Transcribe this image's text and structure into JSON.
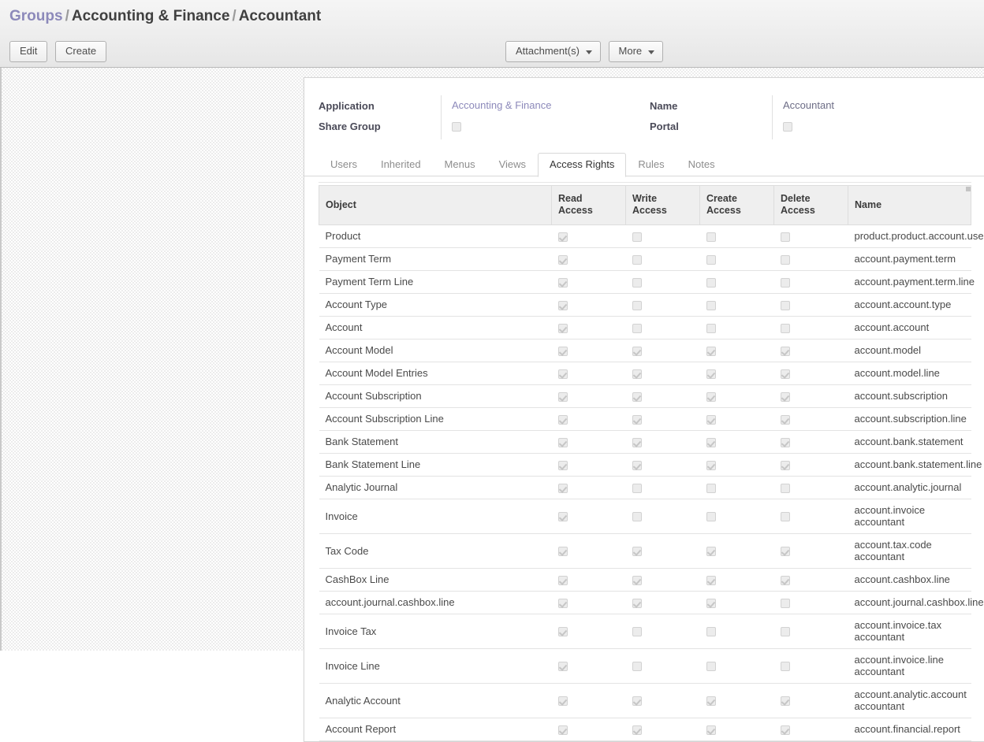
{
  "breadcrumb": {
    "root": "Groups",
    "sep": "/",
    "parent": "Accounting & Finance",
    "current": "Accountant"
  },
  "toolbar": {
    "edit_label": "Edit",
    "create_label": "Create",
    "attachments_label": "Attachment(s)",
    "more_label": "More"
  },
  "form": {
    "labels": {
      "application": "Application",
      "share_group": "Share Group",
      "name": "Name",
      "portal": "Portal"
    },
    "values": {
      "application": "Accounting & Finance",
      "share_group_checked": false,
      "name": "Accountant",
      "portal_checked": false
    }
  },
  "tabs": [
    {
      "label": "Users",
      "active": false
    },
    {
      "label": "Inherited",
      "active": false
    },
    {
      "label": "Menus",
      "active": false
    },
    {
      "label": "Views",
      "active": false
    },
    {
      "label": "Access Rights",
      "active": true
    },
    {
      "label": "Rules",
      "active": false
    },
    {
      "label": "Notes",
      "active": false
    }
  ],
  "table": {
    "columns": [
      "Object",
      "Read Access",
      "Write Access",
      "Create Access",
      "Delete Access",
      "Name"
    ],
    "column_lines": [
      [
        "Object"
      ],
      [
        "Read",
        "Access"
      ],
      [
        "Write",
        "Access"
      ],
      [
        "Create",
        "Access"
      ],
      [
        "Delete",
        "Access"
      ],
      [
        "Name"
      ]
    ],
    "rows": [
      {
        "object": "Product",
        "read": true,
        "write": false,
        "create": false,
        "delete": false,
        "name": "product.product.account.user"
      },
      {
        "object": "Payment Term",
        "read": true,
        "write": false,
        "create": false,
        "delete": false,
        "name": "account.payment.term"
      },
      {
        "object": "Payment Term Line",
        "read": true,
        "write": false,
        "create": false,
        "delete": false,
        "name": "account.payment.term.line"
      },
      {
        "object": "Account Type",
        "read": true,
        "write": false,
        "create": false,
        "delete": false,
        "name": "account.account.type"
      },
      {
        "object": "Account",
        "read": true,
        "write": false,
        "create": false,
        "delete": false,
        "name": "account.account"
      },
      {
        "object": "Account Model",
        "read": true,
        "write": true,
        "create": true,
        "delete": true,
        "name": "account.model"
      },
      {
        "object": "Account Model Entries",
        "read": true,
        "write": true,
        "create": true,
        "delete": true,
        "name": "account.model.line"
      },
      {
        "object": "Account Subscription",
        "read": true,
        "write": true,
        "create": true,
        "delete": true,
        "name": "account.subscription"
      },
      {
        "object": "Account Subscription Line",
        "read": true,
        "write": true,
        "create": true,
        "delete": true,
        "name": "account.subscription.line"
      },
      {
        "object": "Bank Statement",
        "read": true,
        "write": true,
        "create": true,
        "delete": true,
        "name": "account.bank.statement"
      },
      {
        "object": "Bank Statement Line",
        "read": true,
        "write": true,
        "create": true,
        "delete": true,
        "name": "account.bank.statement.line"
      },
      {
        "object": "Analytic Journal",
        "read": true,
        "write": false,
        "create": false,
        "delete": false,
        "name": "account.analytic.journal"
      },
      {
        "object": "Invoice",
        "read": true,
        "write": false,
        "create": false,
        "delete": false,
        "name": "account.invoice accountant"
      },
      {
        "object": "Tax Code",
        "read": true,
        "write": true,
        "create": true,
        "delete": true,
        "name": "account.tax.code accountant"
      },
      {
        "object": "CashBox Line",
        "read": true,
        "write": true,
        "create": true,
        "delete": true,
        "name": "account.cashbox.line"
      },
      {
        "object": "account.journal.cashbox.line",
        "read": true,
        "write": true,
        "create": true,
        "delete": false,
        "name": "account.journal.cashbox.line"
      },
      {
        "object": "Invoice Tax",
        "read": true,
        "write": false,
        "create": false,
        "delete": false,
        "name": "account.invoice.tax accountant"
      },
      {
        "object": "Invoice Line",
        "read": true,
        "write": false,
        "create": false,
        "delete": false,
        "name": "account.invoice.line accountant"
      },
      {
        "object": "Analytic Account",
        "read": true,
        "write": true,
        "create": true,
        "delete": true,
        "name": "account.analytic.account accountant"
      },
      {
        "object": "Account Report",
        "read": true,
        "write": true,
        "create": true,
        "delete": true,
        "name": "account.financial.report"
      }
    ]
  },
  "colors": {
    "link": "#8c89ba",
    "header_bg": "#ededed",
    "table_header_bg": "#efefef",
    "text": "#4c4c4c"
  }
}
